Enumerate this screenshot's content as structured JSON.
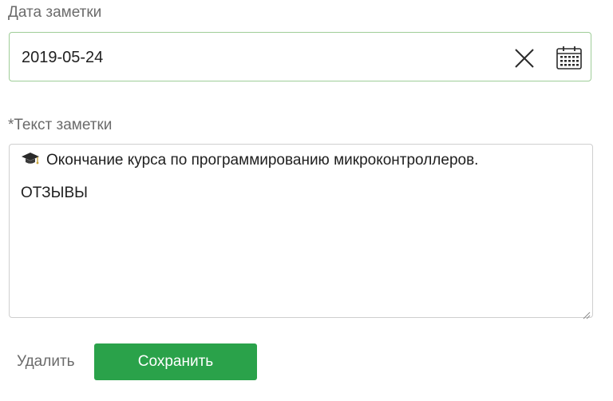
{
  "date_field": {
    "label": "Дата заметки",
    "value": "2019-05-24",
    "clear_icon": "close-icon",
    "calendar_icon": "calendar-icon",
    "border_color": "#9fcd98"
  },
  "text_field": {
    "label": "*Текст заметки",
    "lines": [
      "Окончание курса по программированию микроконтроллеров.",
      "ОТЗЫВЫ"
    ],
    "emoji_icon": "graduation-cap-icon"
  },
  "actions": {
    "delete_label": "Удалить",
    "save_label": "Сохранить",
    "save_color": "#2aa24a"
  }
}
